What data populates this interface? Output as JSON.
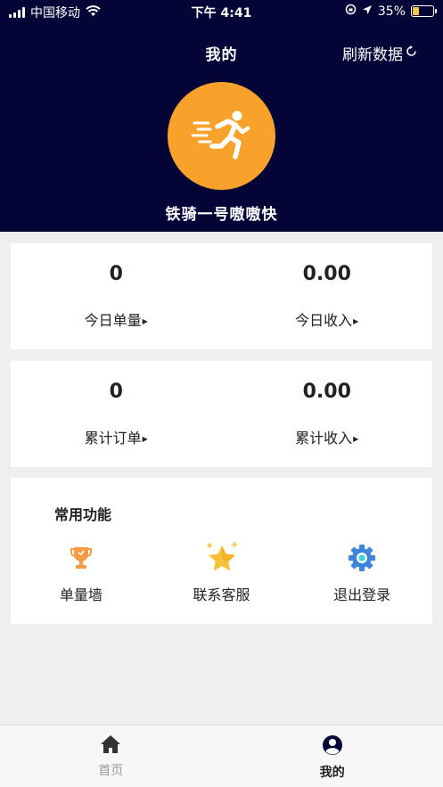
{
  "status_bar": {
    "carrier": "中国移动",
    "time": "下午 4:41",
    "battery_percent": "35%",
    "battery_level": 0.35,
    "icons": [
      "signal-icon",
      "wifi-icon",
      "rotation-lock-icon",
      "location-arrow-icon",
      "battery-icon"
    ]
  },
  "header": {
    "title": "我的",
    "refresh_label": "刷新数据",
    "username": "铁骑一号嗷嗷快",
    "avatar_icon": "running-man-icon",
    "avatar_color": "#f8a22c",
    "background_color": "#040537"
  },
  "today": {
    "orders_value": "0",
    "orders_label": "今日单量",
    "income_value": "0.00",
    "income_label": "今日收入"
  },
  "total": {
    "orders_value": "0",
    "orders_label": "累计订单",
    "income_value": "0.00",
    "income_label": "累计收入"
  },
  "functions": {
    "title": "常用功能",
    "items": [
      {
        "label": "单量墙",
        "icon": "trophy-icon"
      },
      {
        "label": "联系客服",
        "icon": "star-icon"
      },
      {
        "label": "退出登录",
        "icon": "gear-icon"
      }
    ]
  },
  "tabbar": {
    "home_label": "首页",
    "mine_label": "我的"
  }
}
